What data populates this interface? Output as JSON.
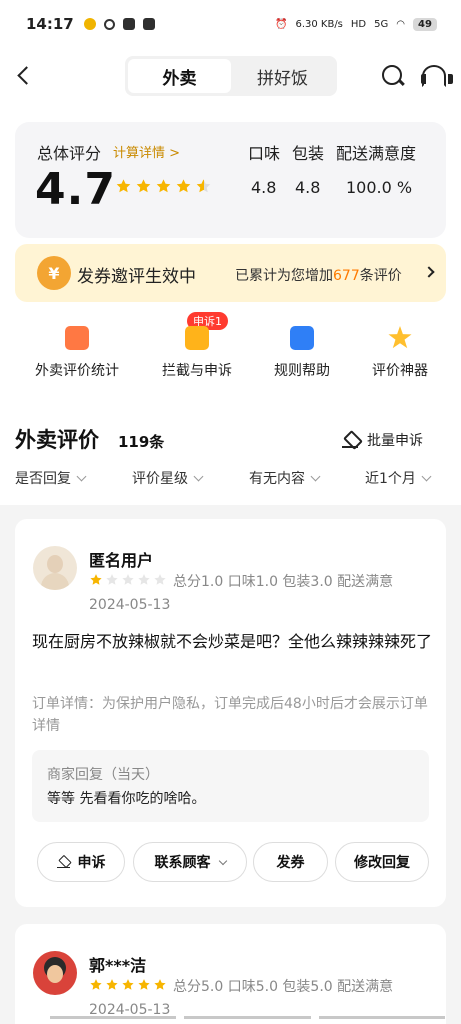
{
  "status_bar": {
    "time": "14:17",
    "network_speed": "6.30 KB/s",
    "hd": "HD",
    "signal": "5G",
    "battery": "49"
  },
  "nav": {
    "tabs": [
      "外卖",
      "拼好饭"
    ],
    "active_tab": "外卖"
  },
  "score": {
    "overall_label": "总体评分",
    "details_link": "计算详情 >",
    "value": "4.7",
    "rating_out_of_5": 4.7,
    "metric_labels": [
      "口味",
      "包装",
      "配送满意度"
    ],
    "metric_values": [
      "4.8",
      "4.8",
      "100.0 %"
    ]
  },
  "coupon": {
    "badge": "¥",
    "title": "发券邀评生效中",
    "text_prefix": "已累计为您增加",
    "count": "677",
    "text_suffix": "条评价"
  },
  "quick_links": [
    {
      "label": "外卖评价统计",
      "icon": "bar-chart-icon"
    },
    {
      "label": "拦截与申诉",
      "icon": "lightning-icon",
      "badge": "申诉1"
    },
    {
      "label": "规则帮助",
      "icon": "document-icon"
    },
    {
      "label": "评价神器",
      "icon": "star-icon"
    }
  ],
  "section": {
    "title": "外卖评价",
    "count": "119条",
    "batch_appeal": "批量申诉"
  },
  "filters": [
    "是否回复",
    "评价星级",
    "有无内容",
    "近1个月"
  ],
  "reviews": [
    {
      "user": "匿名用户",
      "rating": 1,
      "metrics": "总分1.0   口味1.0   包装3.0   配送满意",
      "date": "2024-05-13",
      "content": "现在厨房不放辣椒就不会炒菜是吧？全他么辣辣辣辣死了",
      "order_detail": "订单详情：为保护用户隐私，订单完成后48小时后才会展示订单详情",
      "reply_title": "商家回复（当天）",
      "reply": "等等 先看看你吃的啥哈。",
      "actions": [
        "申诉",
        "联系顾客",
        "发券",
        "修改回复"
      ]
    },
    {
      "user": "郭***洁",
      "rating": 5,
      "metrics": "总分5.0   口味5.0   包装5.0   配送满意",
      "date": "2024-05-13"
    }
  ],
  "colors": {
    "accent_yellow": "#ffbf2e",
    "coupon_bg": "#fff4d4",
    "appeal_red": "#ff3b30"
  }
}
